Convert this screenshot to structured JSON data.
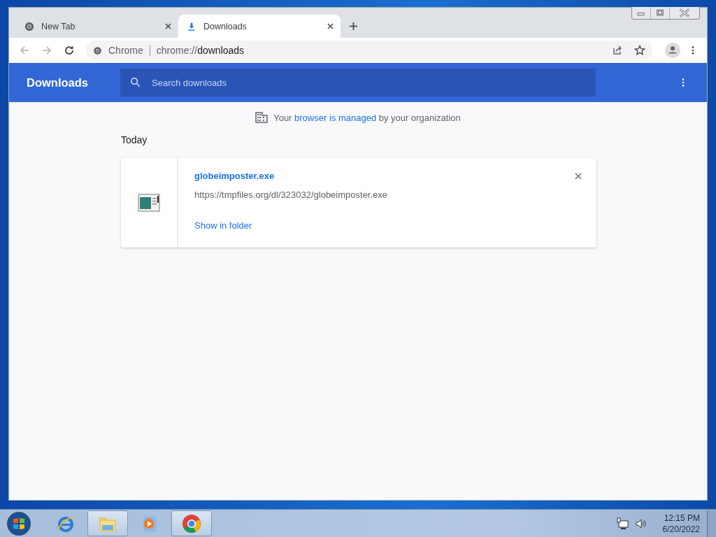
{
  "tabs": [
    {
      "label": "New Tab",
      "selected": false,
      "kind": "chrome"
    },
    {
      "label": "Downloads",
      "selected": true,
      "kind": "download"
    }
  ],
  "omnibox": {
    "site": "Chrome",
    "url_scheme": "chrome://",
    "url_path": "downloads"
  },
  "header": {
    "title": "Downloads",
    "search": {
      "placeholder": "Search downloads"
    }
  },
  "managed_notice": {
    "before": "Your",
    "link": "browser is managed",
    "after": "by your organization"
  },
  "section": "Today",
  "downloads": [
    {
      "filename": "globeimposter.exe",
      "url": "https://tmpfiles.org/dl/323032/globeimposter.exe",
      "action": "Show in folder"
    }
  ],
  "taskbar": {
    "apps": [
      {
        "kind": "ie",
        "running": false
      },
      {
        "kind": "explorer",
        "running": true
      },
      {
        "kind": "media",
        "running": false
      },
      {
        "kind": "chrome",
        "running": true
      }
    ],
    "time": "12:15 PM",
    "date": "6/20/2022"
  }
}
